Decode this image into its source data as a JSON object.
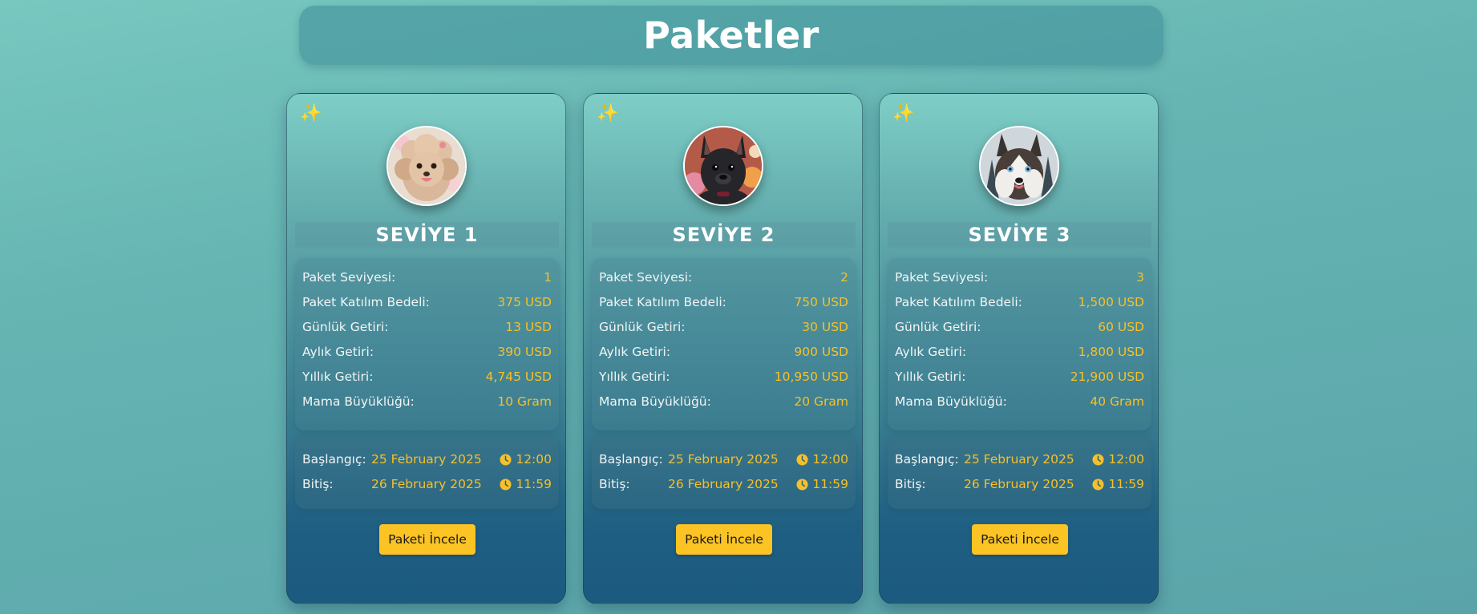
{
  "page": {
    "title": "Paketler"
  },
  "packages": [
    {
      "level_title": "SEVİYE 1",
      "avatar": "poodle-avatar",
      "rows": [
        {
          "label": "Paket Seviyesi:",
          "value": "1"
        },
        {
          "label": "Paket Katılım Bedeli:",
          "value": "375 USD"
        },
        {
          "label": "Günlük Getiri:",
          "value": "13 USD"
        },
        {
          "label": "Aylık Getiri:",
          "value": "390 USD"
        },
        {
          "label": "Yıllık Getiri:",
          "value": "4,745 USD"
        },
        {
          "label": "Mama Büyüklüğü:",
          "value": "10 Gram"
        }
      ],
      "start_label": "Başlangıç:",
      "start_date": "25 February 2025",
      "start_time": "12:00",
      "end_label": "Bitiş:",
      "end_date": "26 February 2025",
      "end_time": "11:59",
      "button_label": "Paketi İncele"
    },
    {
      "level_title": "SEVİYE 2",
      "avatar": "french-bulldog-avatar",
      "rows": [
        {
          "label": "Paket Seviyesi:",
          "value": "2"
        },
        {
          "label": "Paket Katılım Bedeli:",
          "value": "750 USD"
        },
        {
          "label": "Günlük Getiri:",
          "value": "30 USD"
        },
        {
          "label": "Aylık Getiri:",
          "value": "900 USD"
        },
        {
          "label": "Yıllık Getiri:",
          "value": "10,950 USD"
        },
        {
          "label": "Mama Büyüklüğü:",
          "value": "20 Gram"
        }
      ],
      "start_label": "Başlangıç:",
      "start_date": "25 February 2025",
      "start_time": "12:00",
      "end_label": "Bitiş:",
      "end_date": "26 February 2025",
      "end_time": "11:59",
      "button_label": "Paketi İncele"
    },
    {
      "level_title": "SEVİYE 3",
      "avatar": "husky-avatar",
      "rows": [
        {
          "label": "Paket Seviyesi:",
          "value": "3"
        },
        {
          "label": "Paket Katılım Bedeli:",
          "value": "1,500 USD"
        },
        {
          "label": "Günlük Getiri:",
          "value": "60 USD"
        },
        {
          "label": "Aylık Getiri:",
          "value": "1,800 USD"
        },
        {
          "label": "Yıllık Getiri:",
          "value": "21,900 USD"
        },
        {
          "label": "Mama Büyüklüğü:",
          "value": "40 Gram"
        }
      ],
      "start_label": "Başlangıç:",
      "start_date": "25 February 2025",
      "start_time": "12:00",
      "end_label": "Bitiş:",
      "end_date": "26 February 2025",
      "end_time": "11:59",
      "button_label": "Paketi İncele"
    }
  ],
  "icons": {
    "sparkle": "sparkles-icon",
    "clock": "clock-icon"
  },
  "colors": {
    "accent": "#fbc324",
    "value_text": "#f6c02a",
    "card_top": "#7ecec6",
    "card_bottom": "#1c5a80"
  }
}
